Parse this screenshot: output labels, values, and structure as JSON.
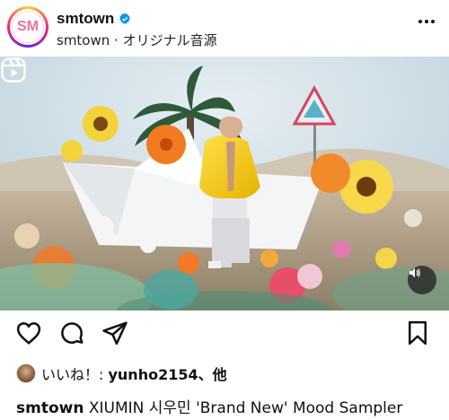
{
  "post": {
    "username": "smtown",
    "subline": "smtown · オリジナル音源",
    "avatar_text": "SM",
    "caption_user": "smtown",
    "caption_text": "XIUMIN 시우민 'Brand New' Mood Sampler"
  },
  "likes": {
    "prefix": "いいね！: ",
    "user": "yunho2154",
    "suffix": "、他"
  },
  "icons": {
    "verified": "verified-badge-icon",
    "more": "more-options-icon",
    "reels": "reels-icon",
    "volume": "volume-icon",
    "like": "heart-icon",
    "comment": "comment-icon",
    "share": "send-icon",
    "save": "bookmark-icon"
  },
  "colors": {
    "verified_blue": "#0095f6",
    "ring_gradient": [
      "#f9ce34",
      "#ee2a7b",
      "#6228d7"
    ]
  }
}
